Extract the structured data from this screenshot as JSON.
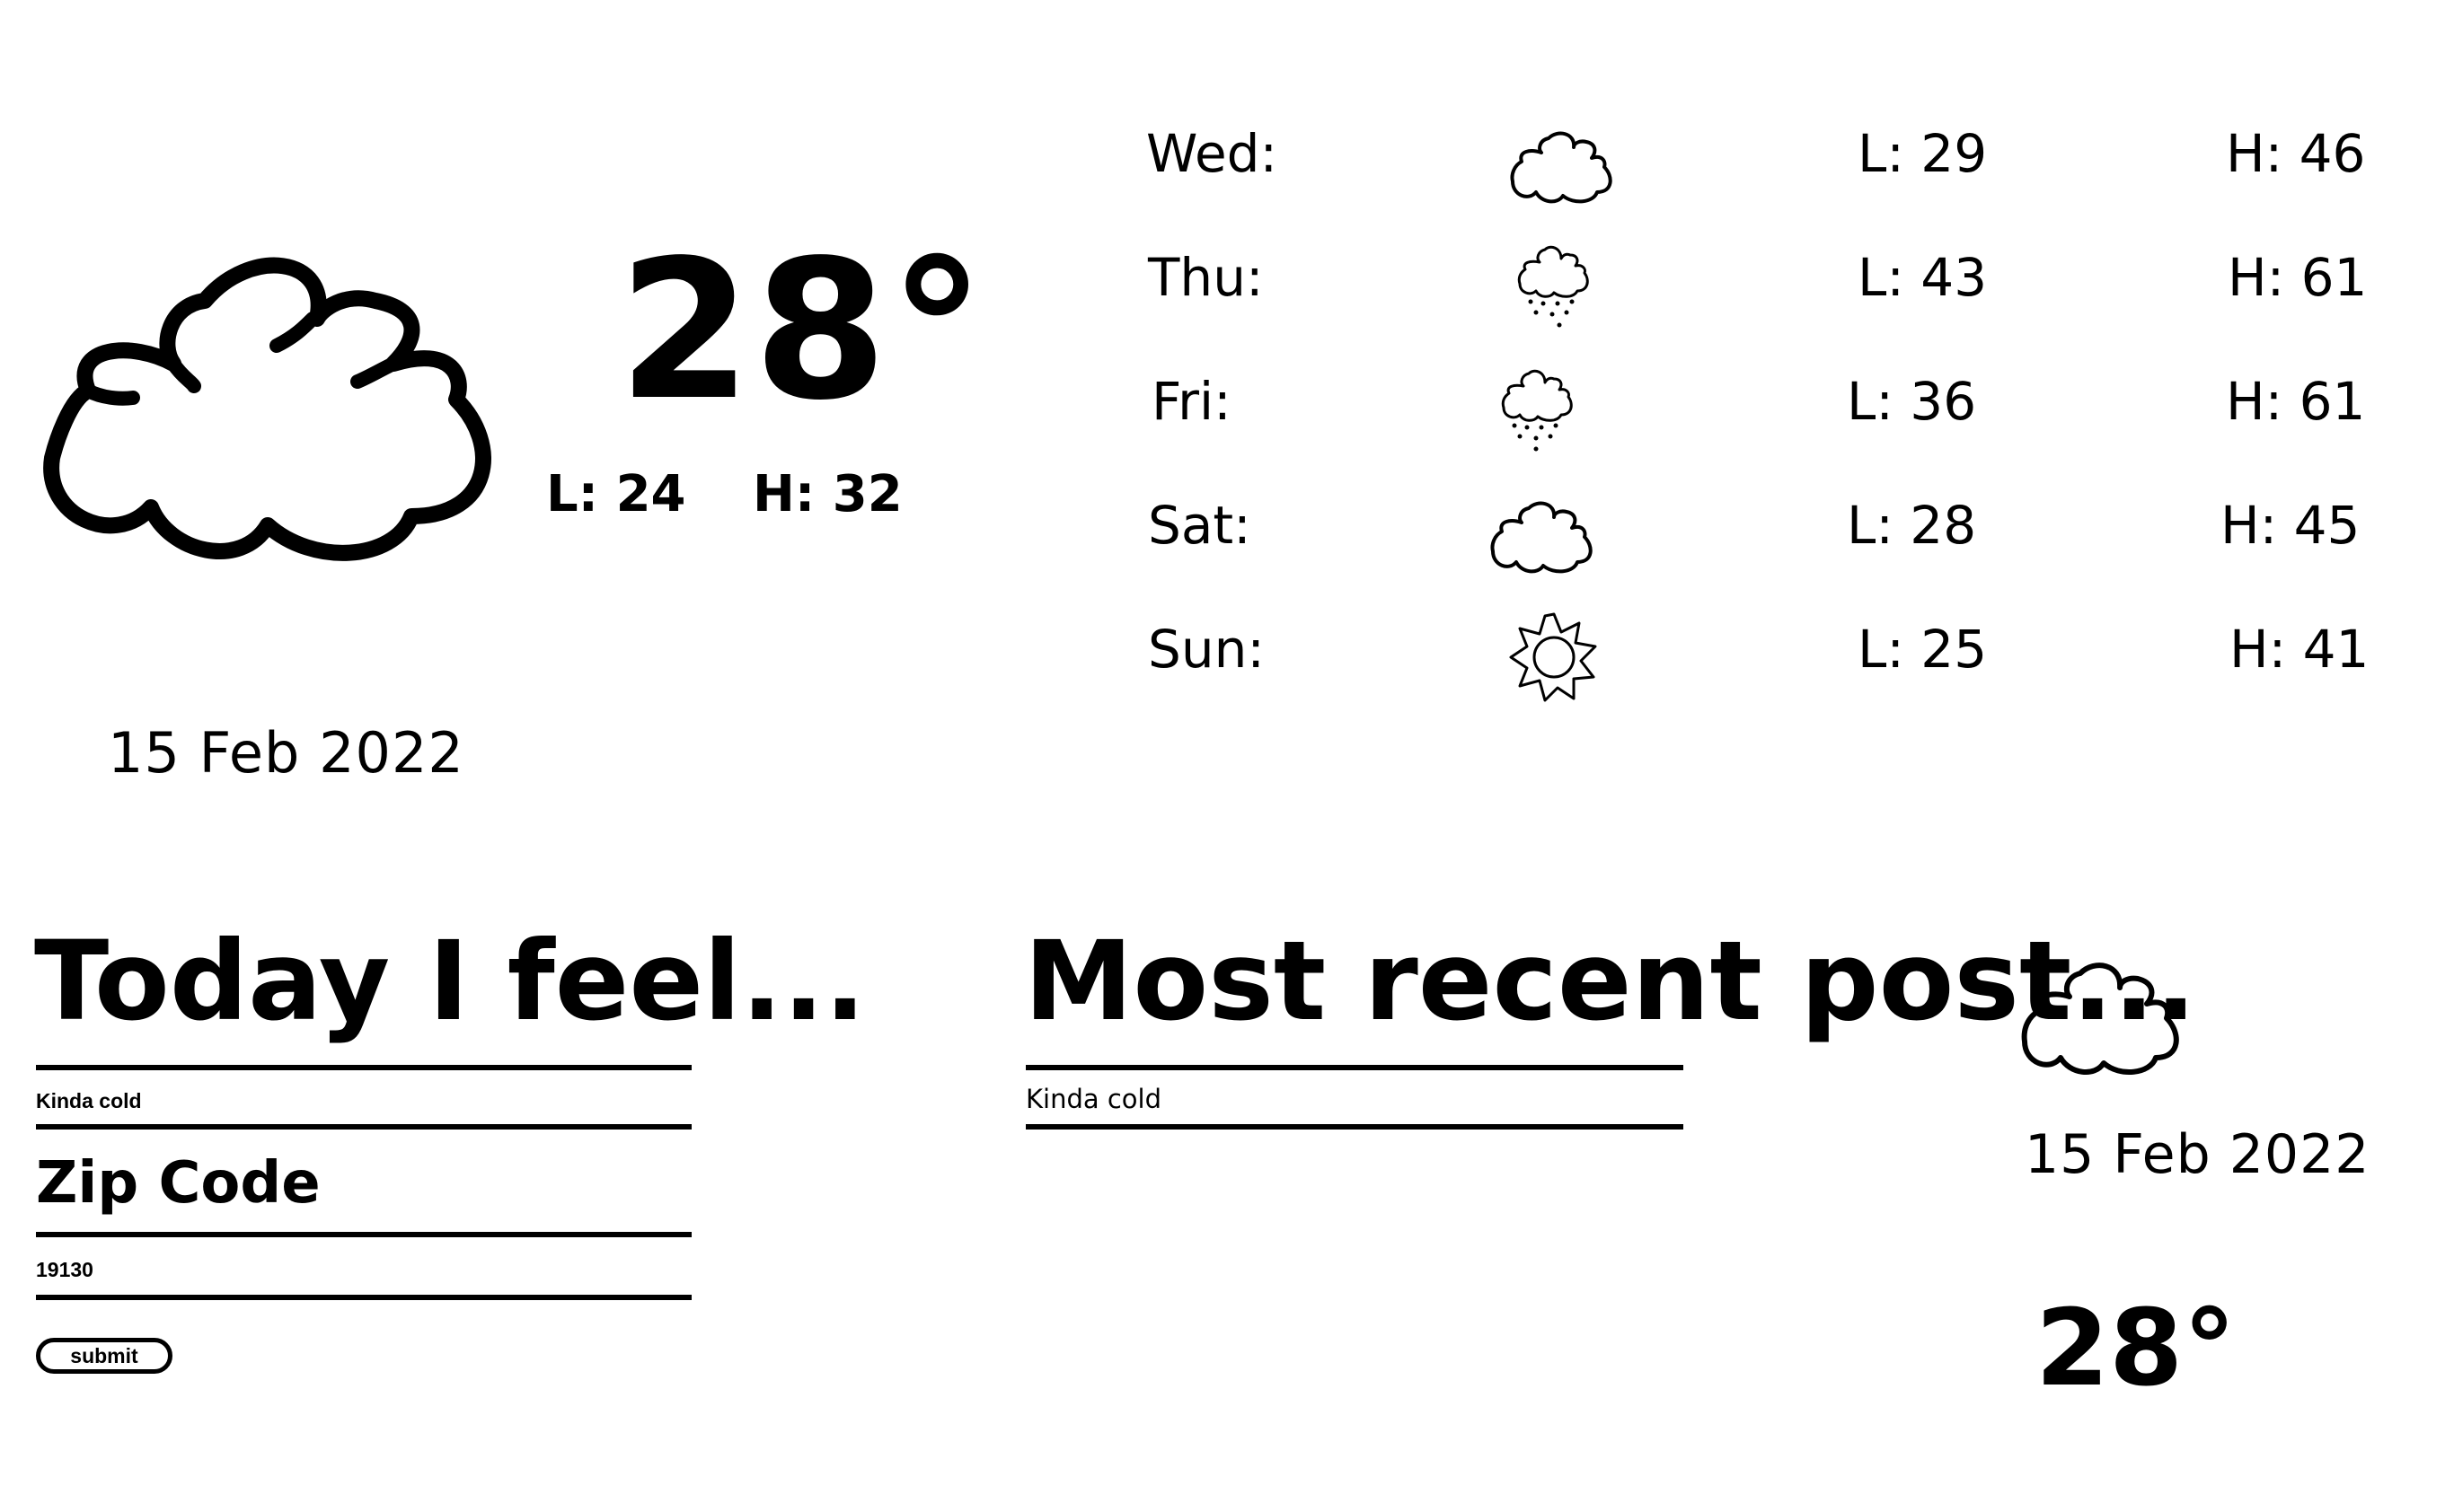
{
  "current": {
    "icon": "cloud-icon",
    "temperature": "28°",
    "low": "L: 24",
    "high": "H: 32",
    "date": "15 Feb 2022"
  },
  "forecast": [
    {
      "day": "Wed:",
      "icon": "cloud-icon",
      "low": "L: 29",
      "high": "H: 46"
    },
    {
      "day": "Thu:",
      "icon": "rain-cloud-icon",
      "low": "L: 43",
      "high": "H: 61"
    },
    {
      "day": "Fri:",
      "icon": "rain-cloud-icon",
      "low": "L: 36",
      "high": "H: 61"
    },
    {
      "day": "Sat:",
      "icon": "cloud-icon",
      "low": "L: 28",
      "high": "H: 45"
    },
    {
      "day": "Sun:",
      "icon": "sun-icon",
      "low": "L: 25",
      "high": "H: 41"
    }
  ],
  "feel_form": {
    "heading": "Today I feel...",
    "feeling_value": "Kinda cold",
    "zip_label": "Zip Code",
    "zip_value": "19130",
    "submit_label": "submit"
  },
  "recent_post": {
    "heading": "Most recent post...",
    "text": "Kinda cold",
    "icon": "cloud-icon",
    "date": "15 Feb 2022",
    "temperature": "28°"
  }
}
